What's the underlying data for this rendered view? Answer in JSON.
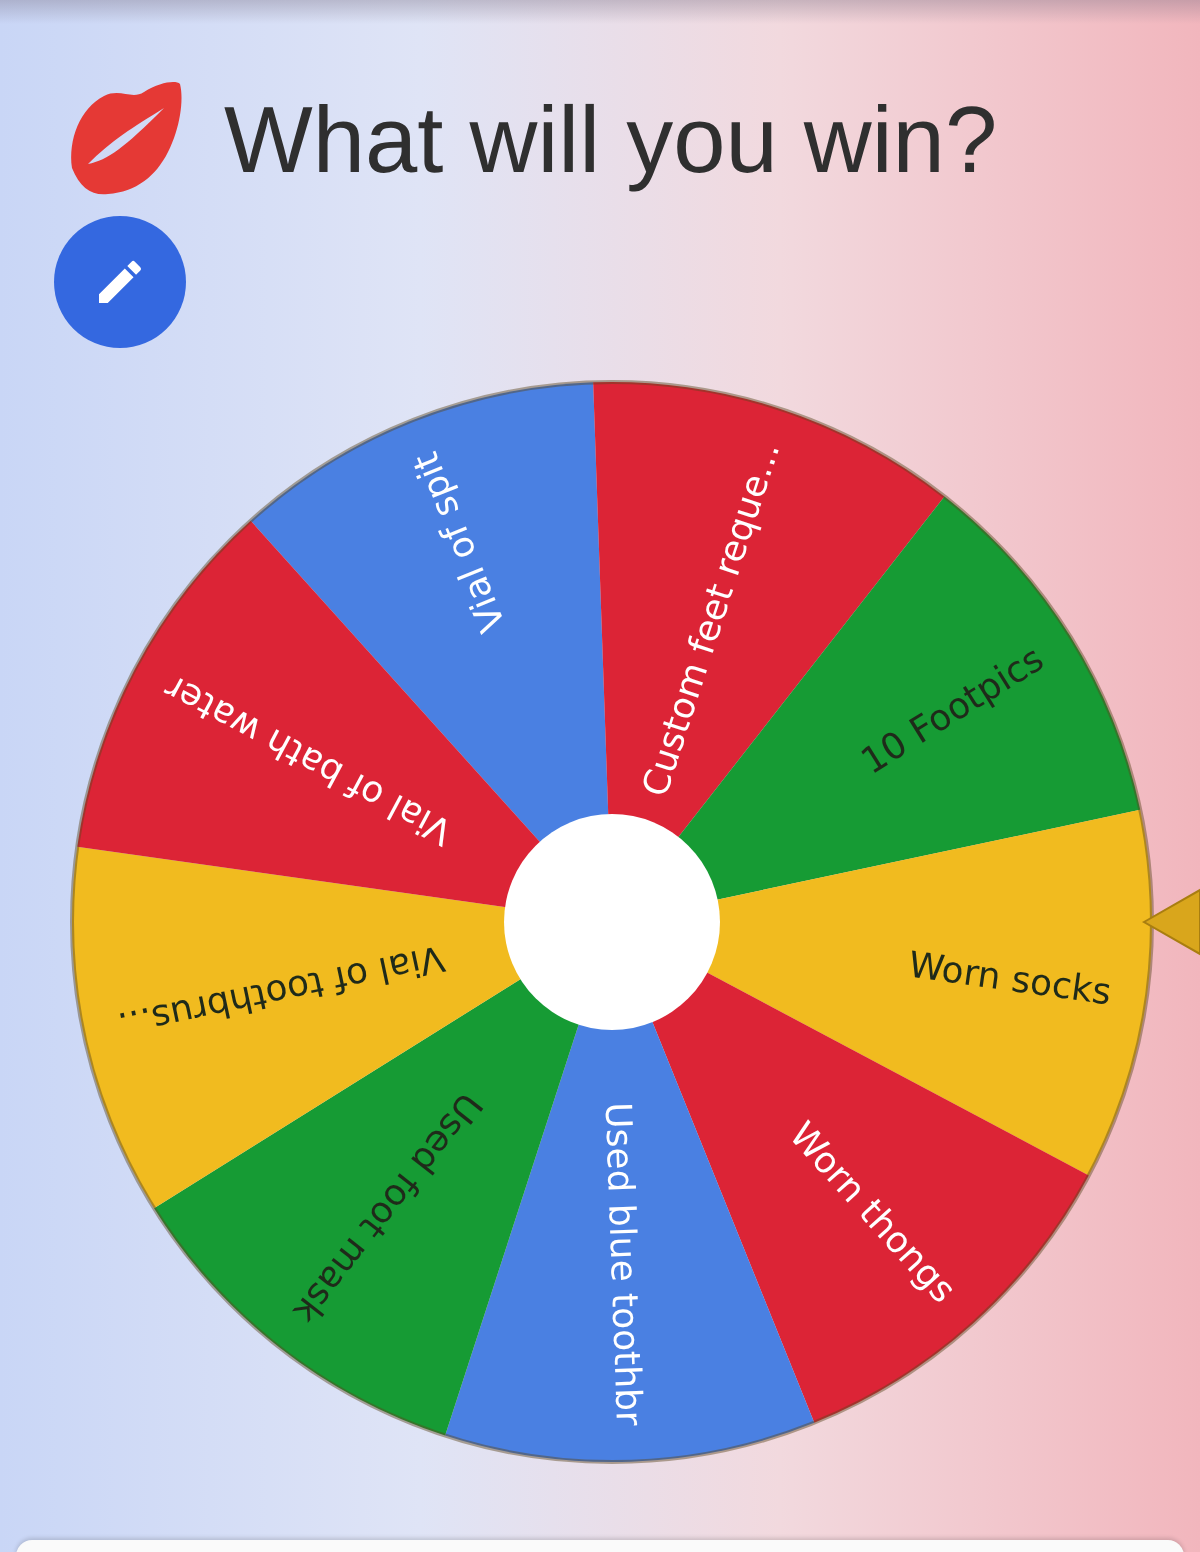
{
  "title": "What will you win?",
  "wheel": {
    "segments": [
      {
        "label": "Vial of spit",
        "color": "#4a80e2"
      },
      {
        "label": "Custom feet reque...",
        "color": "#dc2436"
      },
      {
        "label": "10 Footpics",
        "color": "#169b34"
      },
      {
        "label": "Worn socks",
        "color": "#f1bb1f"
      },
      {
        "label": "Worn thongs",
        "color": "#dc2436"
      },
      {
        "label": "Used blue toothbr",
        "color": "#4a80e2"
      },
      {
        "label": "Used foot mask",
        "color": "#169b34"
      },
      {
        "label": "Vial of toothbrus...",
        "color": "#f1bb1f"
      },
      {
        "label": "Vial of bath water",
        "color": "#dc2436"
      }
    ]
  }
}
